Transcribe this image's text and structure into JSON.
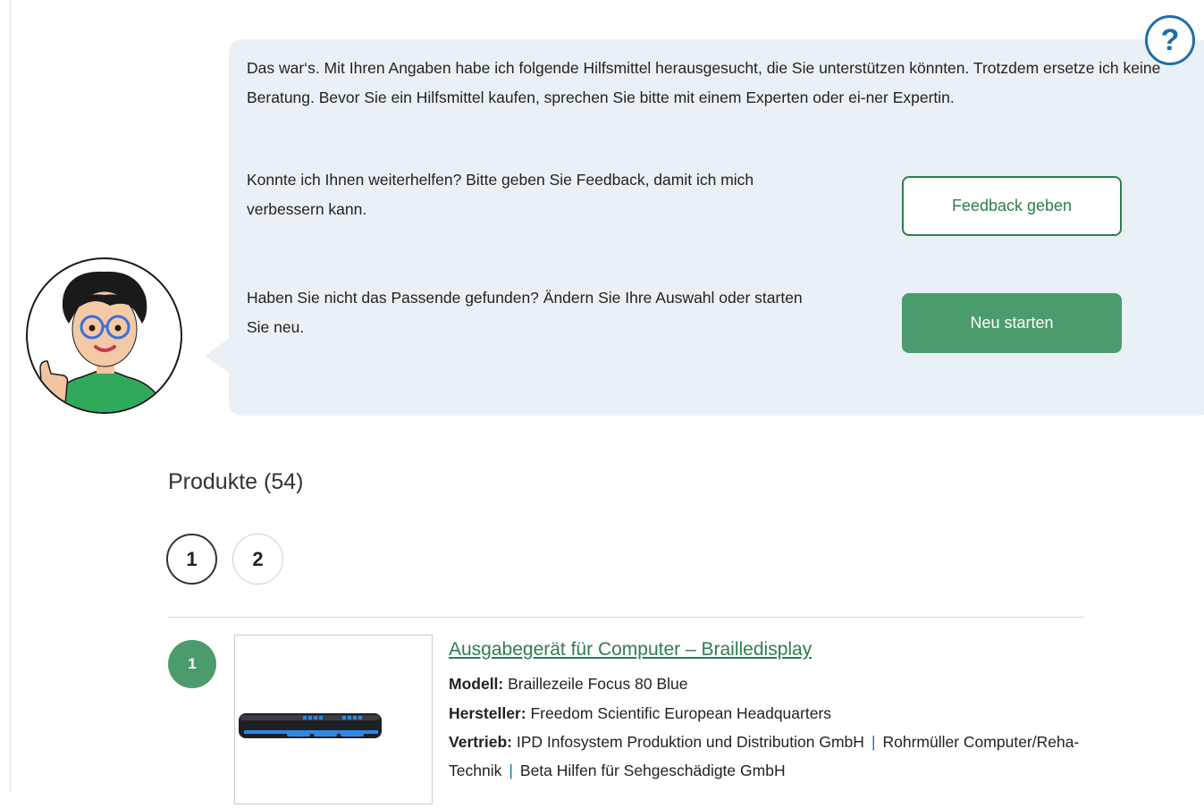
{
  "help": {
    "label": "?"
  },
  "assistant": {
    "intro": "Das war‘s. Mit Ihren Angaben habe ich folgende Hilfsmittel herausgesucht, die Sie unterstützen könnten. Trotzdem ersetze ich keine Beratung. Bevor Sie ein Hilfsmittel kaufen, sprechen Sie bitte mit einem Experten oder ei-ner Expertin.",
    "feedback_text": "Konnte ich Ihnen weiterhelfen? Bitte geben Sie Feedback, damit ich mich verbessern kann.",
    "feedback_button": "Feedback geben",
    "restart_text": "Haben Sie nicht das Passende gefunden? Ändern Sie Ihre Auswahl oder starten Sie neu.",
    "restart_button": "Neu starten"
  },
  "products": {
    "heading": "Produkte (54)",
    "pages": [
      "1",
      "2"
    ],
    "items": [
      {
        "number": "1",
        "title": "Ausgabegerät für Computer – Brailledisplay",
        "modell_label": "Modell:",
        "modell": "Braillezeile Focus 80 Blue",
        "hersteller_label": "Hersteller:",
        "hersteller": "Freedom Scientific European Headquarters",
        "vertrieb_label": "Vertrieb:",
        "vertrieb": [
          "IPD Infosystem Produktion und Distribution GmbH",
          "Rohrmüller Computer/Reha-Technik",
          "Beta Hilfen für Sehgeschädigte GmbH"
        ],
        "separator": "|"
      }
    ]
  },
  "colors": {
    "accent_green": "#4c9b6c",
    "link_green": "#2e7d4f",
    "help_blue": "#1e6fa8",
    "bubble_bg": "#eaf1f6"
  },
  "icons": {
    "help": "question-mark-icon",
    "avatar": "assistant-avatar",
    "product": "braille-display-image"
  }
}
